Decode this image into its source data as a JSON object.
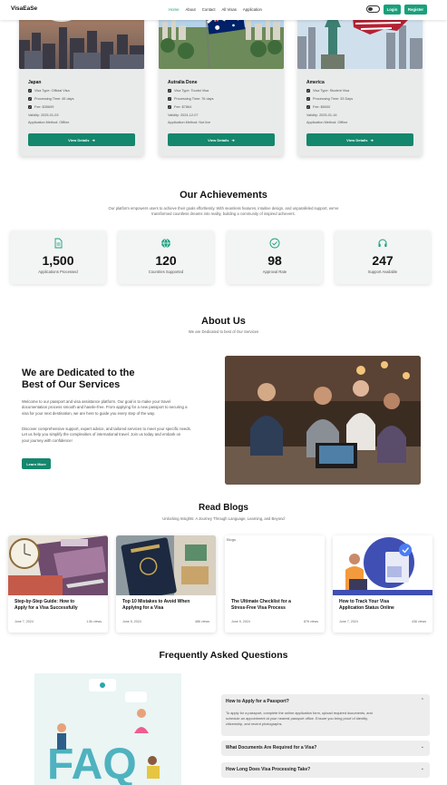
{
  "nav": {
    "brand": "VisaEaSe",
    "items": [
      "Home",
      "About",
      "Contact",
      "All Visas",
      "Application"
    ],
    "login": "Login",
    "register": "Register"
  },
  "visas": [
    {
      "country": "Japan",
      "visa_type": "Visa Type: Official Visa",
      "processing": "Processing Time: 45 days",
      "fee": "Fee: $35699",
      "validity": "Validity: 2025-01-03",
      "method": "Application Method: Offline",
      "button": "View Details"
    },
    {
      "country": "Autralia Done",
      "visa_type": "Visa Type: Tourist Visa",
      "processing": "Processing Time: 76 days",
      "fee": "Fee: $7864",
      "validity": "Validity: 2024-12-07",
      "method": "Application Method: Not live",
      "button": "View Details"
    },
    {
      "country": "America",
      "visa_type": "Visa Type: Student Visa",
      "processing": "Processing Time: 33 Days",
      "fee": "Fee: $6000",
      "validity": "Validity: 2025-01-16",
      "method": "Application Method: Offline",
      "button": "View Details"
    }
  ],
  "achievements": {
    "title": "Our Achievements",
    "subtitle_1": "Our platform empowers users to achieve their goals effortlessly. With seamless features, intuitive design, and unparalleled support, we've",
    "subtitle_2": "transformed countless dreams into reality, building a community of inspired achievers.",
    "stats": [
      {
        "number": "1,500",
        "label": "Applications Processed",
        "icon": "document-icon"
      },
      {
        "number": "120",
        "label": "Countries Supported",
        "icon": "globe-icon"
      },
      {
        "number": "98",
        "label": "Approval Rate",
        "icon": "check-circle-icon"
      },
      {
        "number": "247",
        "label": "Support Available",
        "icon": "headset-icon"
      }
    ]
  },
  "about": {
    "title": "About Us",
    "subtitle": "We are Dedicated to best of Our Services",
    "heading_1": "We are Dedicated to the",
    "heading_2": "Best of Our Services",
    "para1_1": "Welcome to our passport and visa assistance platform. Our goal is to make your travel",
    "para1_2": "documentation process smooth and hassle-free. From applying for a new passport to securing a",
    "para1_3": "visa for your next destination, we are here to guide you every step of the way.",
    "para2_1": "Discover comprehensive support, expert advice, and tailored services to meet your specific needs.",
    "para2_2": "Let us help you simplify the complexities of international travel. Join us today and embark on",
    "para2_3": "your journey with confidence!",
    "button": "Learn More"
  },
  "blogs": {
    "title": "Read Blogs",
    "subtitle": "Unlocking Insights: A Journey Through Language, Learning, and Beyond",
    "items": [
      {
        "title_1": "Step-by-Step Guide: How to",
        "title_2": "Apply for a Visa Successfully",
        "date": "June 7, 2024",
        "views": "1.5k views",
        "alt": ""
      },
      {
        "title_1": "Top 10 Mistakes to Avoid When",
        "title_2": "Applying for a Visa",
        "date": "June 5, 2024",
        "views": "486 views",
        "alt": ""
      },
      {
        "title_1": "The Ultimate Checklist for a",
        "title_2": "Stress-Free Visa Process",
        "date": "June 9, 2024",
        "views": "876 views",
        "alt": "Blogs"
      },
      {
        "title_1": "How to Track Your Visa",
        "title_2": "Application Status Online",
        "date": "June 7, 2024",
        "views": "436 views",
        "alt": ""
      }
    ]
  },
  "faq": {
    "title": "Frequently Asked Questions",
    "art_text": "FAQ",
    "items": [
      {
        "question": "How to Apply for a Passport?",
        "answer_1": "To apply for a passport, complete the online application form, upload required documents, and",
        "answer_2": "schedule an appointment at your nearest passport office. Ensure you bring proof of identity,",
        "answer_3": "citizenship, and recent photographs."
      },
      {
        "question": "What Documents Are Required for a Visa?"
      },
      {
        "question": "How Long Does Visa Processing Take?"
      }
    ]
  },
  "colors": {
    "accent": "#19a07c",
    "accent_dark": "#14876d"
  }
}
